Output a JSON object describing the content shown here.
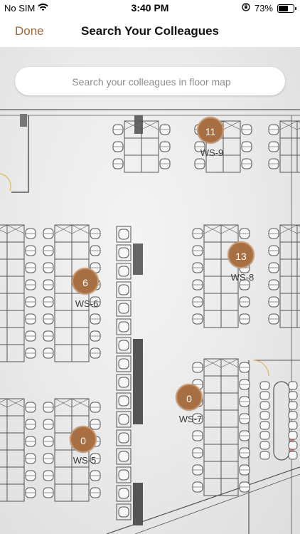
{
  "status_bar": {
    "carrier": "No SIM",
    "time": "3:40 PM",
    "battery": "73%",
    "battery_level": 0.73
  },
  "nav": {
    "done_label": "Done",
    "title": "Search Your Colleagues"
  },
  "search": {
    "placeholder": "Search your colleagues in floor map",
    "value": ""
  },
  "accent_color": "#a86f43",
  "workstations": [
    {
      "count": "11",
      "label": "WS-9"
    },
    {
      "count": "13",
      "label": "WS-8"
    },
    {
      "count": "6",
      "label": "WS-6"
    },
    {
      "count": "0",
      "label": "WS-7"
    },
    {
      "count": "0",
      "label": "WS-5"
    }
  ]
}
